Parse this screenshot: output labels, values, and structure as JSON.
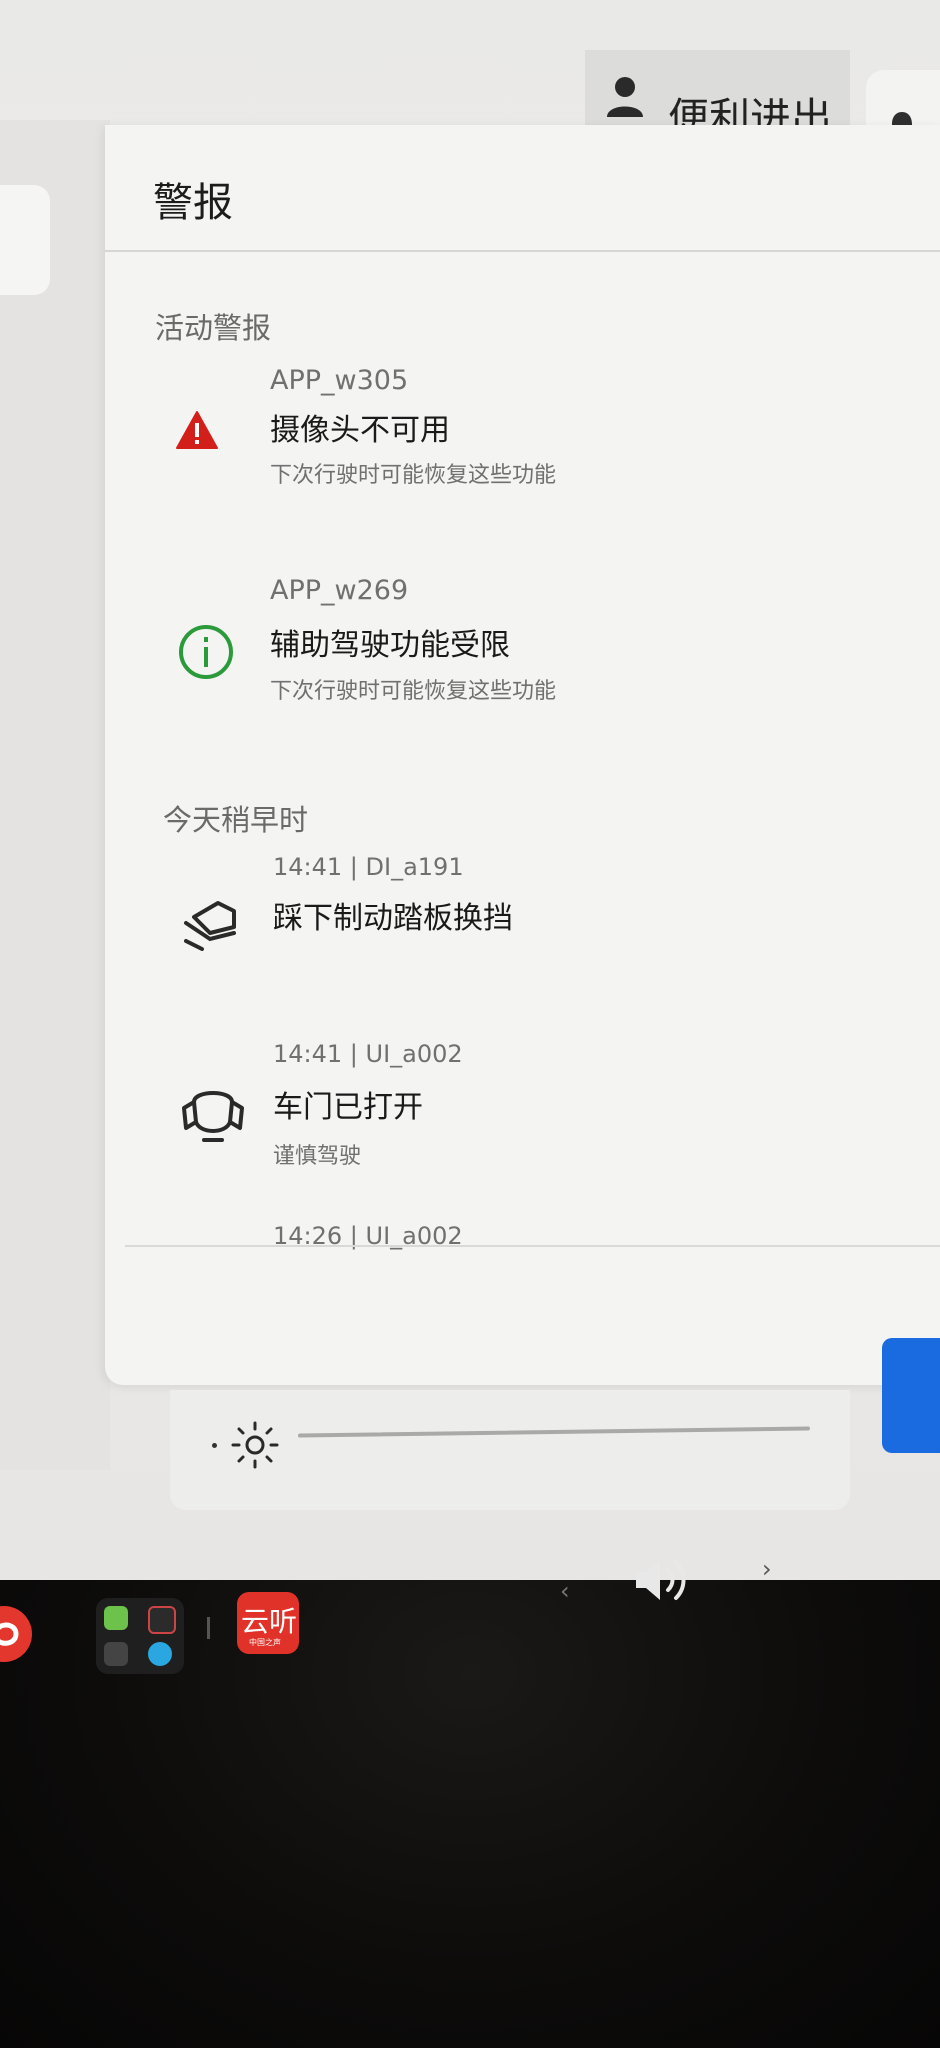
{
  "topbar": {
    "profile_label": "便利进出",
    "icons": [
      "user-icon",
      "bell-icon"
    ]
  },
  "panel": {
    "title": "警报",
    "active_section": "活动警报",
    "earlier_section": "今天稍早时",
    "active_alerts": [
      {
        "code": "APP_w305",
        "title": "摄像头不可用",
        "desc": "下次行驶时可能恢复这些功能",
        "icon": "warning-triangle-icon"
      },
      {
        "code": "APP_w269",
        "title": "辅助驾驶功能受限",
        "desc": "下次行驶时可能恢复这些功能",
        "icon": "info-circle-icon"
      }
    ],
    "earlier_alerts": [
      {
        "code": "14:41 | DI_a191",
        "title": "踩下制动踏板换挡",
        "desc": "",
        "icon": "brake-pedal-icon"
      },
      {
        "code": "14:41 | UI_a002",
        "title": "车门已打开",
        "desc": "谨慎驾驶",
        "icon": "car-door-icon"
      },
      {
        "code": "14:26 | UI_a002",
        "title": "",
        "desc": "",
        "icon": ""
      }
    ]
  },
  "colors": {
    "warning": "#d21f1a",
    "info": "#2a9a3a",
    "accent": "#1b6be0"
  },
  "taskbar": {
    "app_label": "云听",
    "app_sub": "中国之声"
  }
}
